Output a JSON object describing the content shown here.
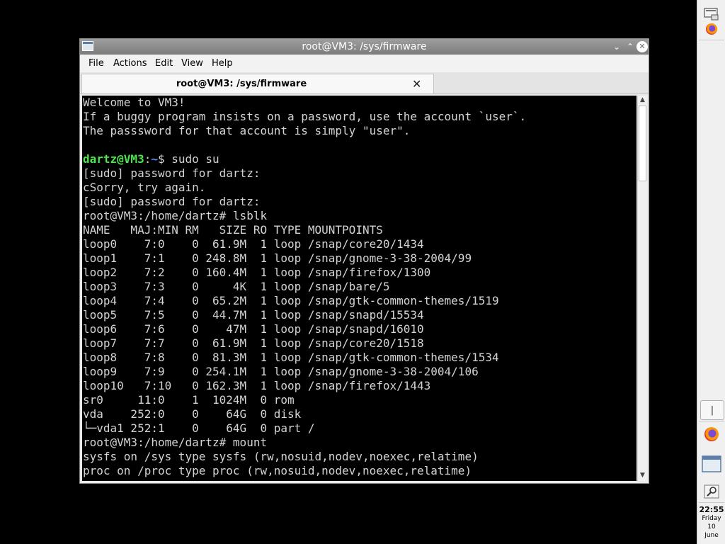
{
  "window": {
    "title": "root@VM3: /sys/firmware",
    "buttons": {
      "minimize": "⌄",
      "maximize": "⌃",
      "close": "✕"
    }
  },
  "menubar": {
    "items": [
      "File",
      "Actions",
      "Edit",
      "View",
      "Help"
    ]
  },
  "tab": {
    "label": "root@VM3: /sys/firmware",
    "close": "✕"
  },
  "terminal": {
    "lines": [
      {
        "text": "Welcome to VM3!"
      },
      {
        "text": "If a buggy program insists on a password, use the account `user`."
      },
      {
        "text": "The passsword for that account is simply \"user\"."
      },
      {
        "text": ""
      },
      {
        "user": "dartz@VM3",
        "sep": ":",
        "path": "~",
        "text": "$ sudo su"
      },
      {
        "text": "[sudo] password for dartz:"
      },
      {
        "text": "cSorry, try again."
      },
      {
        "text": "[sudo] password for dartz:"
      },
      {
        "text": "root@VM3:/home/dartz# lsblk"
      },
      {
        "text": "NAME   MAJ:MIN RM   SIZE RO TYPE MOUNTPOINTS"
      },
      {
        "text": "loop0    7:0    0  61.9M  1 loop /snap/core20/1434"
      },
      {
        "text": "loop1    7:1    0 248.8M  1 loop /snap/gnome-3-38-2004/99"
      },
      {
        "text": "loop2    7:2    0 160.4M  1 loop /snap/firefox/1300"
      },
      {
        "text": "loop3    7:3    0     4K  1 loop /snap/bare/5"
      },
      {
        "text": "loop4    7:4    0  65.2M  1 loop /snap/gtk-common-themes/1519"
      },
      {
        "text": "loop5    7:5    0  44.7M  1 loop /snap/snapd/15534"
      },
      {
        "text": "loop6    7:6    0    47M  1 loop /snap/snapd/16010"
      },
      {
        "text": "loop7    7:7    0  61.9M  1 loop /snap/core20/1518"
      },
      {
        "text": "loop8    7:8    0  81.3M  1 loop /snap/gtk-common-themes/1534"
      },
      {
        "text": "loop9    7:9    0 254.1M  1 loop /snap/gnome-3-38-2004/106"
      },
      {
        "text": "loop10   7:10   0 162.3M  1 loop /snap/firefox/1443"
      },
      {
        "text": "sr0     11:0    1  1024M  0 rom"
      },
      {
        "text": "vda    252:0    0    64G  0 disk"
      },
      {
        "text": "└─vda1 252:1    0    64G  0 part /"
      },
      {
        "text": "root@VM3:/home/dartz# mount"
      },
      {
        "text": "sysfs on /sys type sysfs (rw,nosuid,nodev,noexec,relatime)"
      },
      {
        "text": "proc on /proc type proc (rw,nosuid,nodev,noexec,relatime)"
      }
    ]
  },
  "scrollbar": {
    "up": "▲",
    "down": "▼",
    "position": 0.0
  },
  "taskbar": {
    "icons": [
      "show-desktop-icon",
      "firefox-icon",
      "firefox-icon",
      "terminal-window-icon",
      "search-icon"
    ],
    "pipe_label": "|",
    "clock": {
      "time": "22:55",
      "day": "Friday",
      "date": "10",
      "month": "June"
    }
  },
  "colors": {
    "prompt_user": "#4ce64c",
    "prompt_path": "#5d8df0",
    "terminal_bg": "#000000",
    "terminal_fg": "#d3d3d3"
  }
}
